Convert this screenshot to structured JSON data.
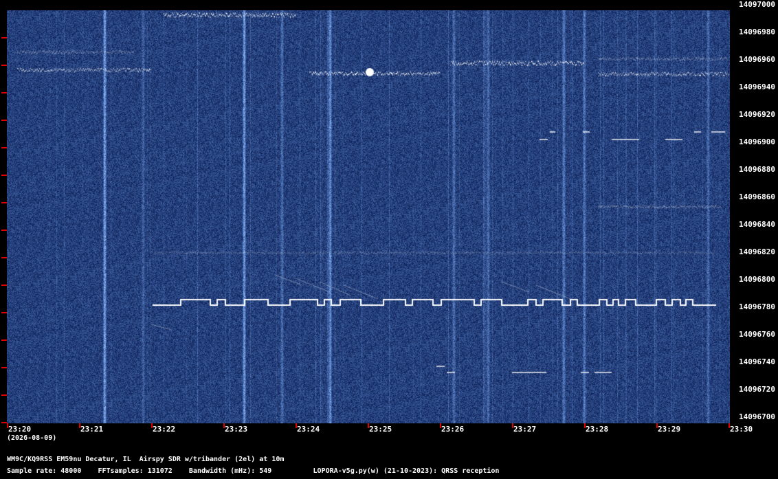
{
  "window": {
    "title": "WM9C/KQ9RSS EM59nu Decatur, IL  Airspy SDR w/tribander (2el) at 10m"
  },
  "chart_data": {
    "type": "heatmap",
    "frequency_axis_labels": [
      "14097000",
      "14096980",
      "14096960",
      "14096940",
      "14096920",
      "14096900",
      "14096880",
      "14096860",
      "14096840",
      "14096820",
      "14096800",
      "14096780",
      "14096760",
      "14096740",
      "14096720",
      "14096700"
    ],
    "frequency_range": [
      14096700,
      14097000
    ],
    "time_axis_labels": [
      "23:20",
      "23:21",
      "23:22",
      "23:23",
      "23:24",
      "23:25",
      "23:26",
      "23:27",
      "23:28",
      "23:29",
      "23:30"
    ],
    "date_label": "(2026-08-09)",
    "colors": {
      "background": "#0a1f55",
      "signal": "#ffffff",
      "tick": "#e00000"
    }
  },
  "footer": {
    "station": "WM9C/KQ9RSS EM59nu Decatur, IL  Airspy SDR w/tribander (2el) at 10m",
    "params": "Sample rate: 48000    FFTsamples: 131072    Bandwidth (mHz): 549          LOPORA-v5g.py(w) (21-10-2023): QRSS reception"
  }
}
